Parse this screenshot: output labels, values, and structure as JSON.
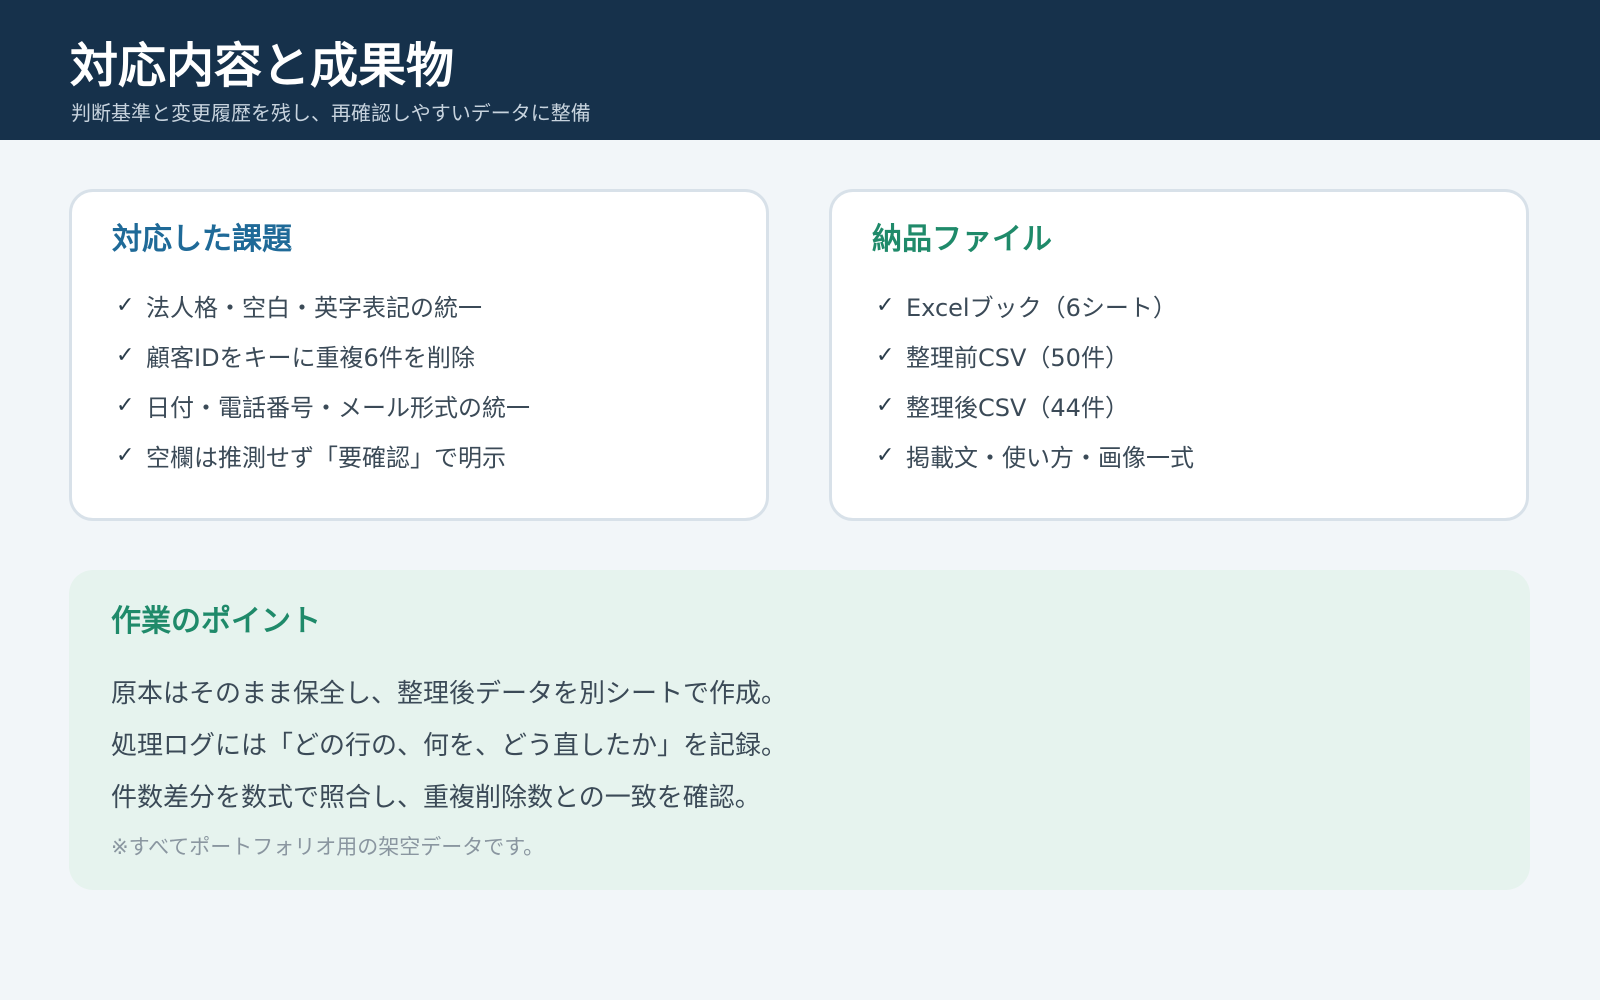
{
  "header": {
    "title": "対応内容と成果物",
    "subtitle": "判断基準と変更履歴を残し、再確認しやすいデータに整備"
  },
  "issues": {
    "title": "対応した課題",
    "items": [
      "法人格・空白・英字表記の統一",
      "顧客IDをキーに重複6件を削除",
      "日付・電話番号・メール形式の統一",
      "空欄は推測せず「要確認」で明示"
    ]
  },
  "deliverables": {
    "title": "納品ファイル",
    "items": [
      "Excelブック（6シート）",
      "整理前CSV（50件）",
      "整理後CSV（44件）",
      "掲載文・使い方・画像一式"
    ]
  },
  "check_mark": "✓",
  "points": {
    "title": "作業のポイント",
    "lines": [
      "原本はそのまま保全し、整理後データを別シートで作成。",
      "処理ログには「どの行の、何を、どう直したか」を記録。",
      "件数差分を数式で照合し、重複削除数との一致を確認。"
    ],
    "note": "※すべてポートフォリオ用の架空データです。"
  },
  "colors": {
    "header_bg": "#16314b",
    "issues_title": "#1f6a98",
    "deliverables_title": "#1f8a6a",
    "points_bg": "#e6f3ee"
  }
}
